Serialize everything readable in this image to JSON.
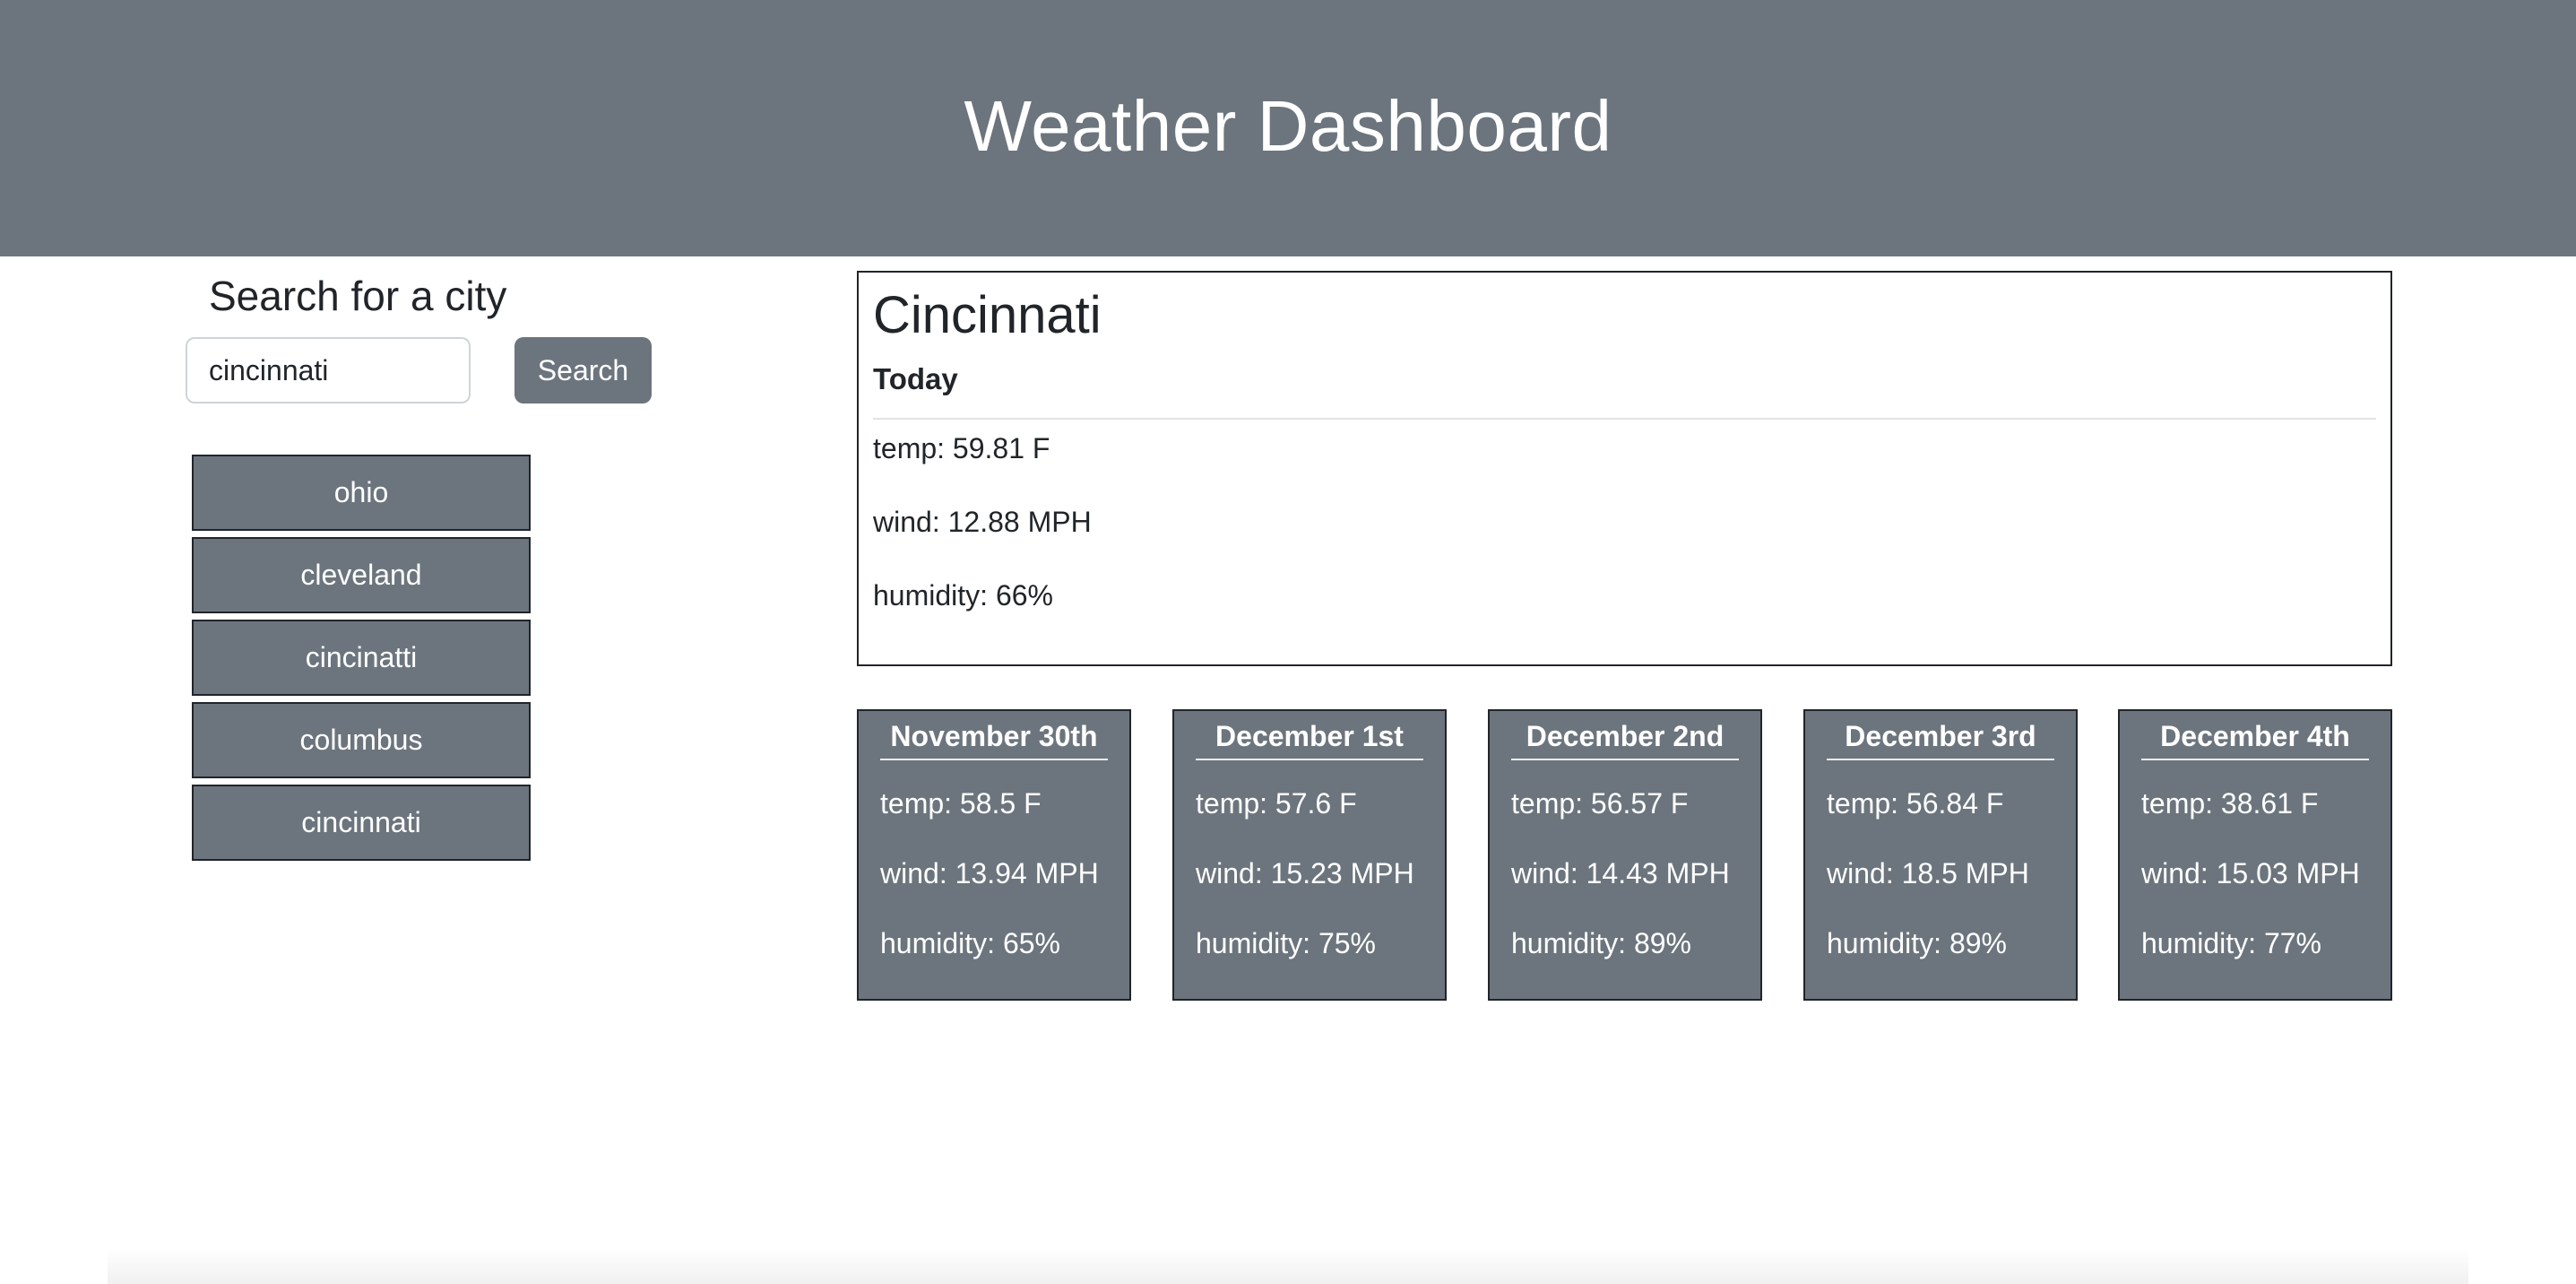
{
  "header": {
    "title": "Weather Dashboard"
  },
  "search": {
    "title": "Search for a city",
    "input_value": "cincinnati",
    "button_label": "Search"
  },
  "history": [
    "ohio",
    "cleveland",
    "cincinatti",
    "columbus",
    "cincinnati"
  ],
  "current": {
    "city": "Cincinnati",
    "day_label": "Today",
    "temp": "temp: 59.81 F",
    "wind": "wind: 12.88 MPH",
    "humidity": "humidity: 66%"
  },
  "forecast": [
    {
      "date": "November 30th",
      "temp": "temp: 58.5 F",
      "wind": "wind: 13.94 MPH",
      "humidity": "humidity: 65%"
    },
    {
      "date": "December 1st",
      "temp": "temp: 57.6 F",
      "wind": "wind: 15.23 MPH",
      "humidity": "humidity: 75%"
    },
    {
      "date": "December 2nd",
      "temp": "temp: 56.57 F",
      "wind": "wind: 14.43 MPH",
      "humidity": "humidity: 89%"
    },
    {
      "date": "December 3rd",
      "temp": "temp: 56.84 F",
      "wind": "wind: 18.5 MPH",
      "humidity": "humidity: 89%"
    },
    {
      "date": "December 4th",
      "temp": "temp: 38.61 F",
      "wind": "wind: 15.03 MPH",
      "humidity": "humidity: 77%"
    }
  ],
  "colors": {
    "header_bg": "#6c757d",
    "button_bg": "#6c757d",
    "text": "#212529",
    "border": "#212529"
  }
}
